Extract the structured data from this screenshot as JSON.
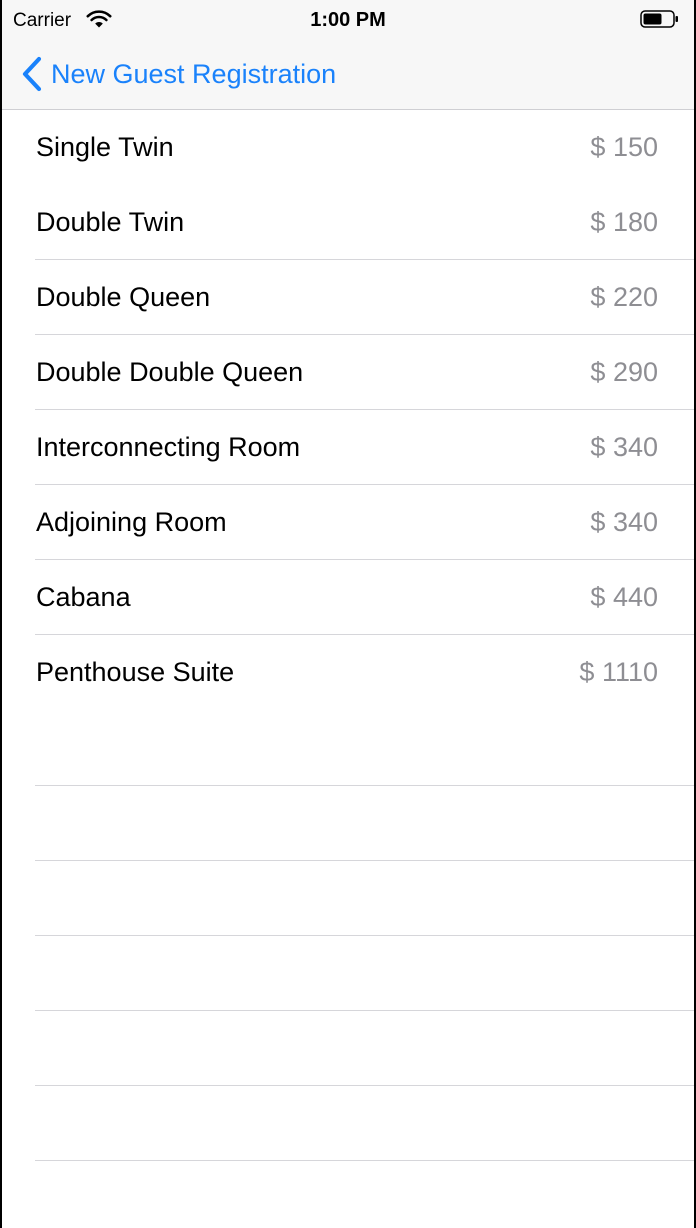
{
  "status_bar": {
    "carrier": "Carrier",
    "time": "1:00 PM",
    "wifi_icon": "wifi-icon",
    "battery_icon": "battery-icon"
  },
  "nav": {
    "back_label": "New Guest Registration",
    "back_icon": "chevron-left-icon",
    "accent_color": "#1a82fb"
  },
  "rooms": [
    {
      "name": "Single Twin",
      "price": "$ 150"
    },
    {
      "name": "Double Twin",
      "price": "$ 180"
    },
    {
      "name": "Double Queen",
      "price": "$ 220"
    },
    {
      "name": "Double Double Queen",
      "price": "$ 290"
    },
    {
      "name": "Interconnecting Room",
      "price": "$ 340"
    },
    {
      "name": "Adjoining Room",
      "price": "$ 340"
    },
    {
      "name": "Cabana",
      "price": "$ 440"
    },
    {
      "name": "Penthouse Suite",
      "price": "$ 1110"
    }
  ],
  "colors": {
    "price_text": "#8e8e93",
    "separator": "#d6d6da"
  }
}
